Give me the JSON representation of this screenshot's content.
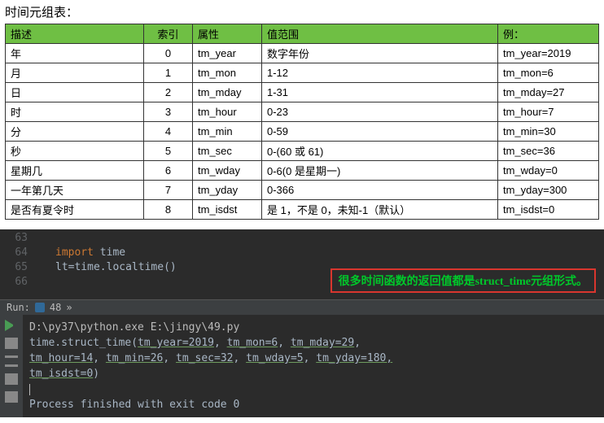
{
  "title": "时间元组表：",
  "columns": {
    "desc": "描述",
    "idx": "索引",
    "attr": "属性",
    "range": "值范围",
    "ex": "例："
  },
  "rows": [
    {
      "desc": "年",
      "idx": "0",
      "attr": "tm_year",
      "range": "数字年份",
      "ex": "tm_year=2019"
    },
    {
      "desc": "月",
      "idx": "1",
      "attr": "tm_mon",
      "range": "1-12",
      "ex": "tm_mon=6"
    },
    {
      "desc": "日",
      "idx": "2",
      "attr": "tm_mday",
      "range": "1-31",
      "ex": "tm_mday=27"
    },
    {
      "desc": "时",
      "idx": "3",
      "attr": "tm_hour",
      "range": "0-23",
      "ex": "tm_hour=7"
    },
    {
      "desc": "分",
      "idx": "4",
      "attr": "tm_min",
      "range": "0-59",
      "ex": "tm_min=30"
    },
    {
      "desc": "秒",
      "idx": "5",
      "attr": "tm_sec",
      "range": "0-(60 或 61)",
      "ex": "tm_sec=36"
    },
    {
      "desc": "星期几",
      "idx": "6",
      "attr": "tm_wday",
      "range": "0-6(0 是星期一)",
      "ex": "tm_wday=0"
    },
    {
      "desc": "一年第几天",
      "idx": "7",
      "attr": "tm_yday",
      "range": "0-366",
      "ex": "tm_yday=300"
    },
    {
      "desc": "是否有夏令时",
      "idx": "8",
      "attr": "tm_isdst",
      "range": "是 1，不是 0，未知-1（默认）",
      "ex": "tm_isdst=0"
    }
  ],
  "editor": {
    "gutter": [
      "63",
      "64",
      "65",
      "66"
    ],
    "line1_import": "import",
    "line1_mod": " time",
    "line2_a": "lt",
    "line2_eq": "=",
    "line2_b": "time.localtime",
    "line2_c": "()"
  },
  "annotation": {
    "pre": "很多时间函数的返回值都是",
    "em": "struct_time",
    "post": "元组形式。"
  },
  "runbar": {
    "label": "Run:",
    "tab": "48",
    "arrow": "»"
  },
  "console": {
    "l1": "D:\\py37\\python.exe E:\\jingy\\49.py",
    "l2a": "time.struct_time(",
    "l2b": "tm_year=2019",
    "l2c": ", ",
    "l2d": "tm_mon=6",
    "l2e": ", ",
    "l2f": "tm_mday=29",
    "l2g": ",",
    "l3a": "tm_hour=14",
    "l3b": ", ",
    "l3c": "tm_min=26",
    "l3d": ", ",
    "l3e": "tm_sec=32",
    "l3f": ", ",
    "l3g": "tm_wday=5",
    "l3h": ", ",
    "l3i": "tm_yday=180,",
    "l4a": "tm_isdst=0",
    "l4b": ")",
    "l6": "Process finished with exit code 0"
  },
  "chart_data": {
    "type": "table",
    "title": "时间元组表",
    "columns": [
      "描述",
      "索引",
      "属性",
      "值范围",
      "例"
    ],
    "rows": [
      [
        "年",
        0,
        "tm_year",
        "数字年份",
        "tm_year=2019"
      ],
      [
        "月",
        1,
        "tm_mon",
        "1-12",
        "tm_mon=6"
      ],
      [
        "日",
        2,
        "tm_mday",
        "1-31",
        "tm_mday=27"
      ],
      [
        "时",
        3,
        "tm_hour",
        "0-23",
        "tm_hour=7"
      ],
      [
        "分",
        4,
        "tm_min",
        "0-59",
        "tm_min=30"
      ],
      [
        "秒",
        5,
        "tm_sec",
        "0-(60 或 61)",
        "tm_sec=36"
      ],
      [
        "星期几",
        6,
        "tm_wday",
        "0-6(0 是星期一)",
        "tm_wday=0"
      ],
      [
        "一年第几天",
        7,
        "tm_yday",
        "0-366",
        "tm_yday=300"
      ],
      [
        "是否有夏令时",
        8,
        "tm_isdst",
        "是 1，不是 0，未知-1（默认）",
        "tm_isdst=0"
      ]
    ]
  }
}
